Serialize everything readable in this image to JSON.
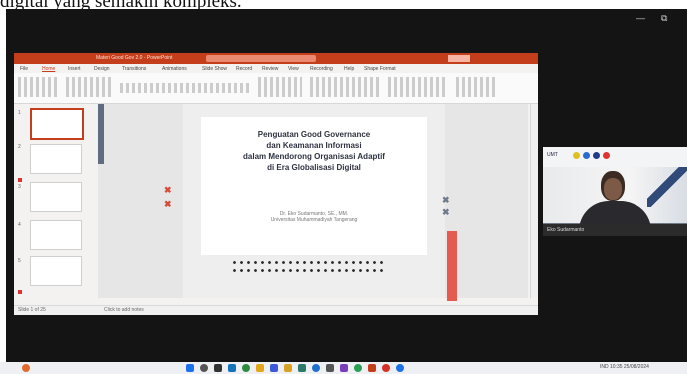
{
  "caption": "digital yang semakin kompleks.",
  "window_controls": [
    "—",
    "⧉"
  ],
  "ppt": {
    "title": "Materi Good Gov 2.0 - PowerPoint",
    "tabs": [
      "File",
      "Home",
      "Insert",
      "Design",
      "Transitions",
      "Animations",
      "Slide Show",
      "Record",
      "Review",
      "View",
      "Recording",
      "Help",
      "Shape Format"
    ],
    "status_left": "Slide 1 of 25",
    "status_notes": "Click to add notes",
    "slide_numbers": [
      "1",
      "2",
      "3",
      "4",
      "5",
      "6"
    ]
  },
  "slide": {
    "title_lines": [
      "Penguatan Good Governance",
      "dan Keamanan Informasi",
      "dalam Mendorong Organisasi Adaptif",
      "di Era Globalisasi Digital"
    ],
    "author": "Dr. Eko Sudarmanto, SE., MM.",
    "institution": "Universitas Muhammadiyah Tangerang"
  },
  "video": {
    "org_label": "UMT",
    "name_label": "Eko Sudarmanto"
  },
  "taskbar": {
    "tray_text": "IND  10:35  25/08/2024"
  },
  "colors": {
    "ppt_accent": "#c43e1c",
    "slide_red": "#e45b4f",
    "slide_blue": "#5f6c84",
    "title_text": "#2e3341"
  },
  "icons": [
    "start-icon",
    "search-icon",
    "task-view-icon",
    "edge-icon",
    "chrome-icon",
    "file-explorer-icon",
    "store-icon",
    "powerpoint-icon",
    "zoom-icon"
  ]
}
